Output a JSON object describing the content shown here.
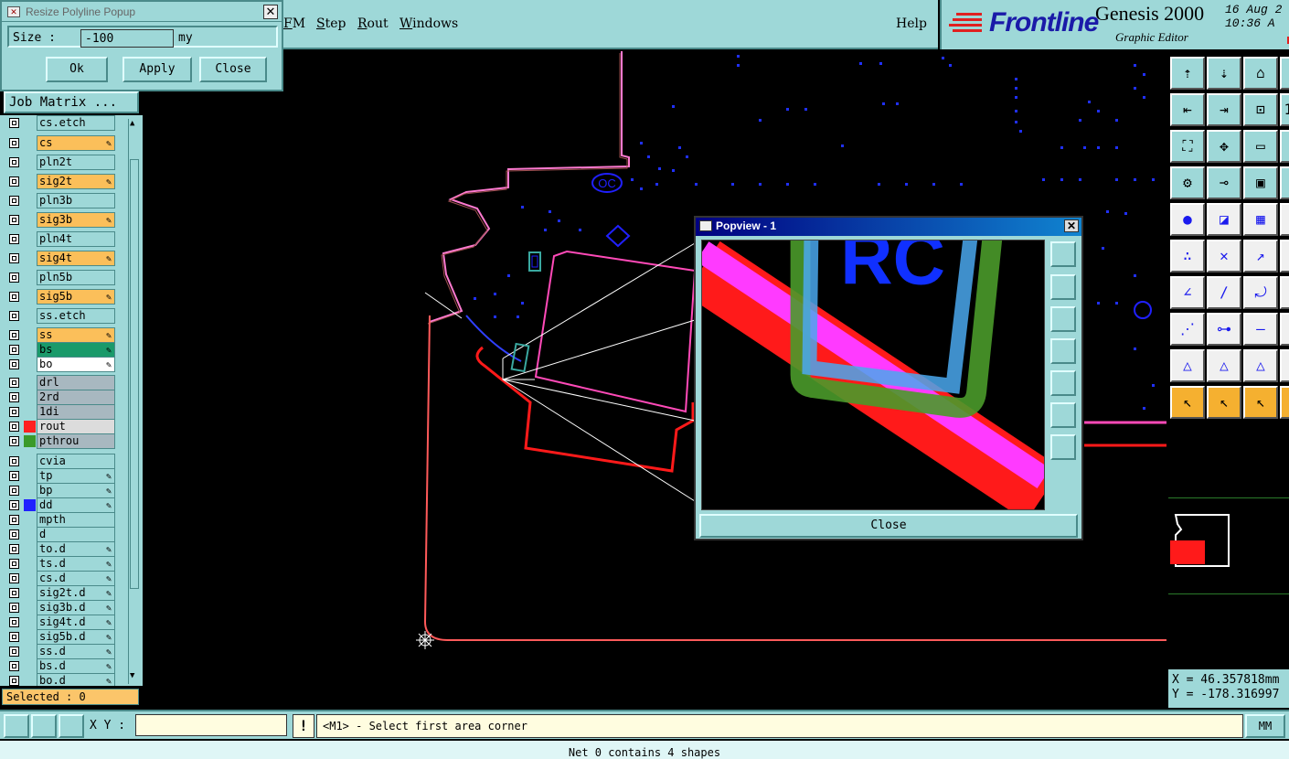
{
  "menubar": {
    "items": [
      "FM",
      "Step",
      "Rout",
      "Windows"
    ],
    "help": "Help"
  },
  "logo": {
    "brand": "Frontline",
    "product": "Genesis 2000",
    "subtitle": "Graphic Editor",
    "date": "16 Aug 2",
    "time": "10:36 A"
  },
  "resize_popup": {
    "title": "Resize Polyline Popup",
    "size_label": "Size :",
    "size_value": "-100",
    "unit": "my",
    "ok": "Ok",
    "apply": "Apply",
    "close": "Close"
  },
  "job_matrix": "Job Matrix ...",
  "layers": [
    {
      "name": "cs.etch",
      "color": "#9ed8d8",
      "swatch": "",
      "edit": false
    },
    {
      "name": "cs",
      "color": "#fbbf5a",
      "swatch": "",
      "edit": true
    },
    {
      "name": "pln2t",
      "color": "#9ed8d8",
      "swatch": "",
      "edit": false
    },
    {
      "name": "sig2t",
      "color": "#fbbf5a",
      "swatch": "",
      "edit": true
    },
    {
      "name": "pln3b",
      "color": "#9ed8d8",
      "swatch": "",
      "edit": false
    },
    {
      "name": "sig3b",
      "color": "#fbbf5a",
      "swatch": "",
      "edit": true
    },
    {
      "name": "pln4t",
      "color": "#9ed8d8",
      "swatch": "",
      "edit": false
    },
    {
      "name": "sig4t",
      "color": "#fbbf5a",
      "swatch": "",
      "edit": true
    },
    {
      "name": "pln5b",
      "color": "#9ed8d8",
      "swatch": "",
      "edit": false
    },
    {
      "name": "sig5b",
      "color": "#fbbf5a",
      "swatch": "",
      "edit": true
    },
    {
      "name": "ss.etch",
      "color": "#9ed8d8",
      "swatch": "",
      "edit": false
    },
    {
      "name": "ss",
      "color": "#fbbf5a",
      "swatch": "",
      "edit": true
    },
    {
      "name": "bs",
      "color": "#1a9a6a",
      "swatch": "",
      "edit": true
    },
    {
      "name": "bo",
      "color": "#ffffff",
      "swatch": "",
      "edit": true
    },
    {
      "name": "drl",
      "color": "#a8b8c0",
      "swatch": "",
      "edit": false
    },
    {
      "name": "2rd",
      "color": "#a8b8c0",
      "swatch": "",
      "edit": false
    },
    {
      "name": "1di",
      "color": "#a8b8c0",
      "swatch": "",
      "edit": false
    },
    {
      "name": "rout",
      "color": "#dcdcdc",
      "swatch": "#ff2020",
      "edit": false
    },
    {
      "name": "pthrou",
      "color": "#a8b8c0",
      "swatch": "#3a9a2a",
      "edit": false
    },
    {
      "name": "cvia",
      "color": "#9ed8d8",
      "swatch": "",
      "edit": false
    },
    {
      "name": "tp",
      "color": "#9ed8d8",
      "swatch": "",
      "edit": true
    },
    {
      "name": "bp",
      "color": "#9ed8d8",
      "swatch": "",
      "edit": true
    },
    {
      "name": "dd",
      "color": "#9ed8d8",
      "swatch": "#2020ff",
      "edit": true
    },
    {
      "name": "mpth",
      "color": "#9ed8d8",
      "swatch": "",
      "edit": false
    },
    {
      "name": "d",
      "color": "#9ed8d8",
      "swatch": "",
      "edit": false
    },
    {
      "name": "to.d",
      "color": "#9ed8d8",
      "swatch": "",
      "edit": true
    },
    {
      "name": "ts.d",
      "color": "#9ed8d8",
      "swatch": "",
      "edit": true
    },
    {
      "name": "cs.d",
      "color": "#9ed8d8",
      "swatch": "",
      "edit": true
    },
    {
      "name": "sig2t.d",
      "color": "#9ed8d8",
      "swatch": "",
      "edit": true
    },
    {
      "name": "sig3b.d",
      "color": "#9ed8d8",
      "swatch": "",
      "edit": true
    },
    {
      "name": "sig4t.d",
      "color": "#9ed8d8",
      "swatch": "",
      "edit": true
    },
    {
      "name": "sig5b.d",
      "color": "#9ed8d8",
      "swatch": "",
      "edit": true
    },
    {
      "name": "ss.d",
      "color": "#9ed8d8",
      "swatch": "",
      "edit": true
    },
    {
      "name": "bs.d",
      "color": "#9ed8d8",
      "swatch": "",
      "edit": true
    },
    {
      "name": "bo.d",
      "color": "#9ed8d8",
      "swatch": "",
      "edit": true
    }
  ],
  "selected": "Selected : 0",
  "status": {
    "xy_label": "X Y :",
    "xy_value": "",
    "prompt": "<M1> - Select first area corner",
    "units": "MM",
    "net": "Net 0 contains 4 shapes"
  },
  "popview": {
    "title": "Popview - 1",
    "close": "Close",
    "label": "RC"
  },
  "canvas_label": "OC",
  "coords": {
    "x": "X = 46.357818mm",
    "y": "Y = -178.316997"
  },
  "colors": {
    "panel": "#9ed8d8",
    "layer_active": "#fbbf5a",
    "rout": "#ff2020",
    "outline": "#ff5ac8",
    "pads": "#2020ff"
  },
  "tool_icons": [
    "layer-up-icon",
    "layer-down-icon",
    "home-icon",
    "inc-icon",
    "left-icon",
    "right-icon",
    "fit-icon",
    "ratio-icon",
    "zoom-fit-icon",
    "zoom-center-icon",
    "scale-icon",
    "snap-icon",
    "measure-icon",
    "net-icon",
    "rout-icon",
    "drill-icon",
    "select-icon",
    "draw-icon",
    "ruler-icon",
    "measure2-icon",
    "node-icon",
    "cross-icon",
    "move-icon",
    "rotate-icon",
    "edit1-icon",
    "edit2-icon",
    "arc-icon",
    "mirror-icon",
    "break-icon",
    "center-icon",
    "line-icon",
    "resize-icon",
    "angle1-icon",
    "angle2-icon",
    "angle3-icon",
    "angle4-icon",
    "pointer-icon",
    "pointer2-icon",
    "pointer3-icon",
    "pointer4-icon"
  ]
}
